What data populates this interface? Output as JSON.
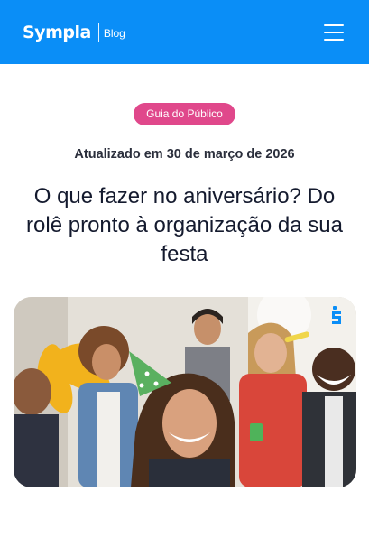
{
  "header": {
    "brand": "Sympla",
    "section": "Blog",
    "menu_icon": "hamburger-menu-icon",
    "background": "#0a8ef7"
  },
  "article": {
    "category": "Guia do Público",
    "category_color": "#e0488b",
    "updated": "Atualizado em 30 de março de 2026",
    "title": "O que fazer no aniversário? Do rolê pronto à organização da sua festa"
  },
  "hero_image": {
    "description_icon": "sympla-s-icon"
  }
}
